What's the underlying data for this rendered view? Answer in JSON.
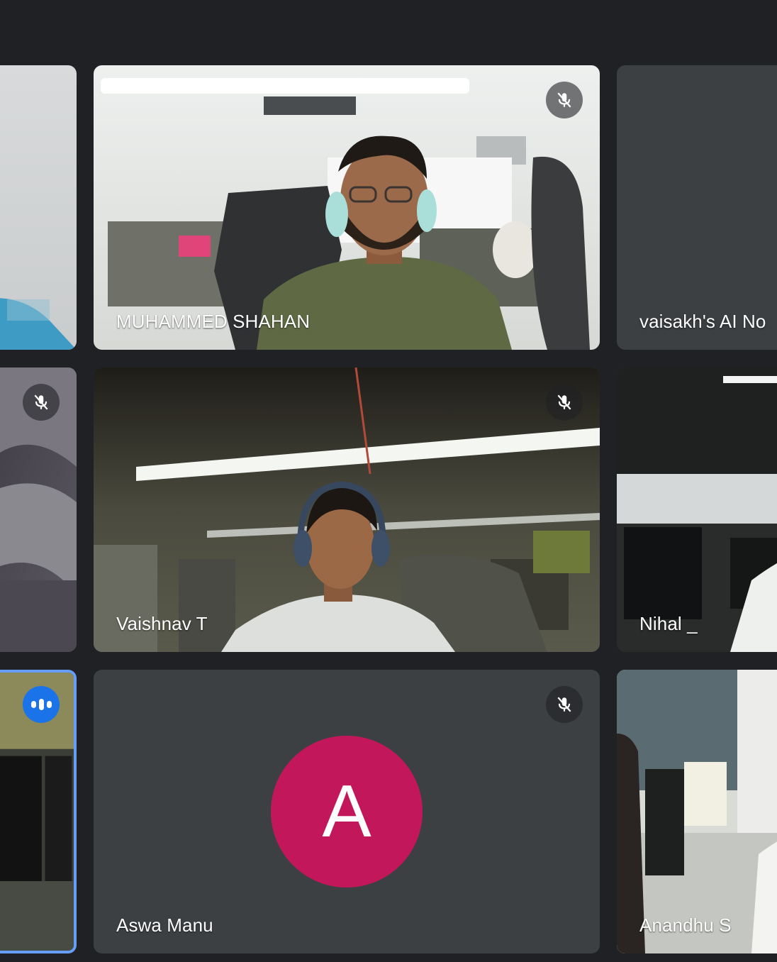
{
  "meeting": {
    "participants": [
      {
        "name": "",
        "muted": false,
        "camera": "on"
      },
      {
        "name": "MUHAMMED SHAHAN",
        "muted": true,
        "camera": "on"
      },
      {
        "name": "vaisakh's AI No",
        "muted": false,
        "camera": "off"
      },
      {
        "name": "",
        "muted": true,
        "camera": "on"
      },
      {
        "name": "Vaishnav T",
        "muted": true,
        "camera": "on"
      },
      {
        "name": "Nihal _",
        "muted": false,
        "camera": "on"
      },
      {
        "name": "",
        "muted": false,
        "camera": "on",
        "speaking": true
      },
      {
        "name": "Aswa Manu",
        "muted": true,
        "camera": "off",
        "avatar_letter": "A",
        "avatar_color": "#c2185b"
      },
      {
        "name": "Anandhu S",
        "muted": false,
        "camera": "on"
      }
    ]
  },
  "icons": {
    "mic_off": "mic-off-icon",
    "speaking": "audio-level-icon"
  },
  "colors": {
    "background": "#202124",
    "tile": "#3c4043",
    "active_border": "#669df6",
    "speaking": "#1a73e8",
    "avatar": "#c2185b"
  }
}
